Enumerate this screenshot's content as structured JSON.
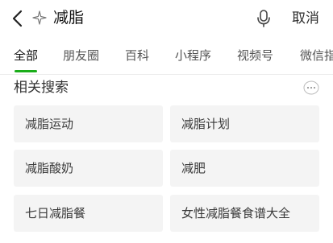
{
  "search": {
    "query": "减脂",
    "cancel_label": "取消"
  },
  "tabs": [
    "全部",
    "朋友圈",
    "百科",
    "小程序",
    "视频号",
    "微信指"
  ],
  "related": {
    "title": "相关搜索",
    "items": [
      "减脂运动",
      "减脂计划",
      "减脂酸奶",
      "减肥",
      "七日减脂餐",
      "女性减脂餐食谱大全"
    ]
  },
  "colors": {
    "accent": "#1aad19",
    "tile_bg": "#f4f4f4"
  },
  "icons": [
    "back-arrow-icon",
    "sparkle-icon",
    "microphone-icon",
    "more-icon"
  ]
}
